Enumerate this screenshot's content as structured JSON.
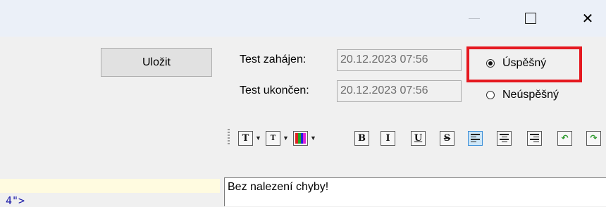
{
  "window": {
    "controls": [
      "minimize",
      "maximize",
      "close"
    ],
    "close_glyph": "✕"
  },
  "left": {
    "save_label": "Uložit",
    "code_fragment": "4\">"
  },
  "test": {
    "started_label": "Test zahájen:",
    "started_value": "20.12.2023 07:56",
    "ended_label": "Test ukončen:",
    "ended_value": "20.12.2023 07:56"
  },
  "result": {
    "options": [
      {
        "label": "Úspěšný",
        "checked": true
      },
      {
        "label": "Neúspěšný",
        "checked": false
      }
    ],
    "highlight_color": "#e5181f"
  },
  "toolbar": {
    "font_glyph": "T",
    "size_glyph": "T",
    "bold": "B",
    "italic": "I",
    "underline": "U",
    "strike": "S",
    "icons": [
      "font-icon",
      "font-size-icon",
      "color-icon",
      "bold-icon",
      "italic-icon",
      "underline-icon",
      "strikethrough-icon",
      "align-left-icon",
      "align-center-icon",
      "align-right-icon",
      "undo-icon",
      "redo-icon"
    ]
  },
  "editor": {
    "text": "Bez nalezení chyby!"
  }
}
